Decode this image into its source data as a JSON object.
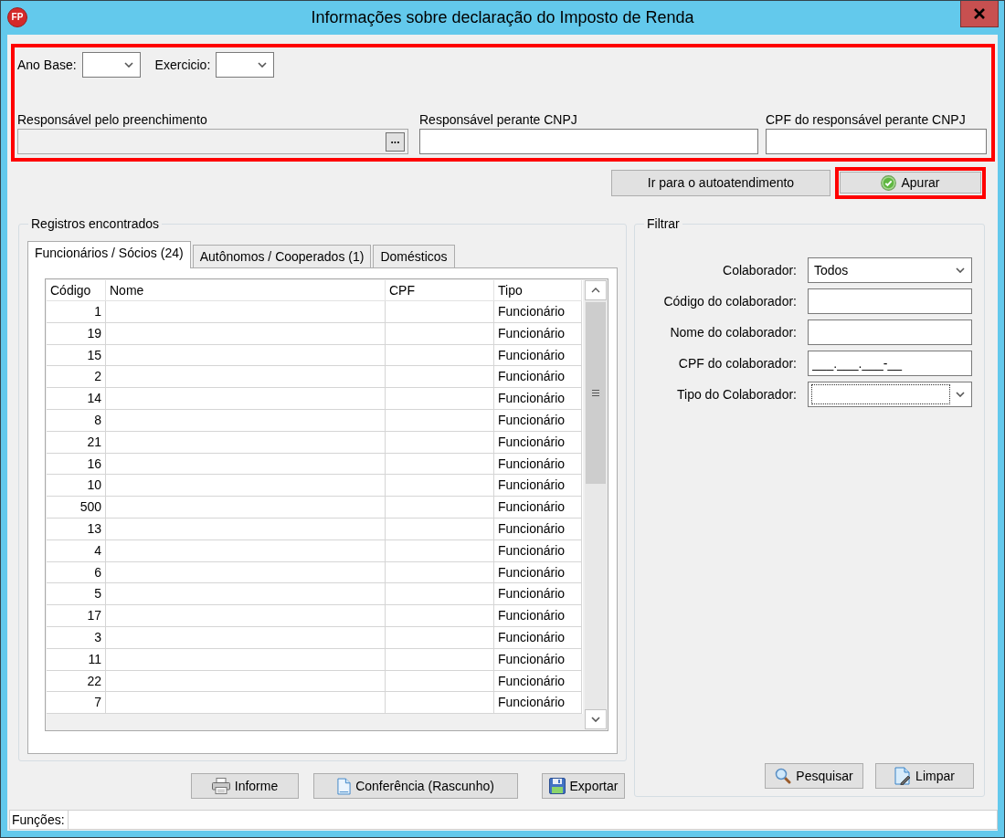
{
  "window": {
    "title": "Informações sobre declaração do Imposto de Renda",
    "logo_text": "FP"
  },
  "header_form": {
    "highlighted": true,
    "selects": [
      {
        "label": "Ano Base:"
      },
      {
        "label": "Exercicio:"
      }
    ],
    "fields": [
      {
        "label": "Responsável pelo preenchimento",
        "kind": "lookup",
        "disabled": true,
        "button": "..."
      },
      {
        "label": "Responsável perante CNPJ",
        "kind": "text",
        "disabled": false
      },
      {
        "label": "CPF do responsável perante CNPJ",
        "kind": "text",
        "disabled": false
      }
    ]
  },
  "actions": [
    {
      "label": "Ir para o autoatendimento",
      "highlighted": false
    },
    {
      "label": "Apurar",
      "highlighted": true
    }
  ],
  "records": {
    "legend": "Registros encontrados",
    "tabs": [
      {
        "label": "Funcionários / Sócios (24)",
        "selected": true
      },
      {
        "label": "Autônomos / Cooperados (1)",
        "selected": false
      },
      {
        "label": "Domésticos",
        "selected": false
      }
    ],
    "table": {
      "columns": [
        "Código",
        "Nome",
        "CPF",
        "Tipo"
      ],
      "rows": [
        {
          "codigo": "1",
          "tipo": "Funcionário"
        },
        {
          "codigo": "19",
          "tipo": "Funcionário"
        },
        {
          "codigo": "15",
          "tipo": "Funcionário"
        },
        {
          "codigo": "2",
          "tipo": "Funcionário"
        },
        {
          "codigo": "14",
          "tipo": "Funcionário"
        },
        {
          "codigo": "8",
          "tipo": "Funcionário"
        },
        {
          "codigo": "21",
          "tipo": "Funcionário"
        },
        {
          "codigo": "16",
          "tipo": "Funcionário"
        },
        {
          "codigo": "10",
          "tipo": "Funcionário"
        },
        {
          "codigo": "500",
          "tipo": "Funcionário"
        },
        {
          "codigo": "13",
          "tipo": "Funcionário"
        },
        {
          "codigo": "4",
          "tipo": "Funcionário"
        },
        {
          "codigo": "6",
          "tipo": "Funcionário"
        },
        {
          "codigo": "5",
          "tipo": "Funcionário"
        },
        {
          "codigo": "17",
          "tipo": "Funcionário"
        },
        {
          "codigo": "3",
          "tipo": "Funcionário"
        },
        {
          "codigo": "11",
          "tipo": "Funcionário"
        },
        {
          "codigo": "22",
          "tipo": "Funcionário"
        },
        {
          "codigo": "7",
          "tipo": "Funcionário"
        }
      ]
    }
  },
  "report_buttons": [
    {
      "label": "Informe"
    },
    {
      "label": "Conferência (Rascunho)"
    },
    {
      "label": "Exportar"
    }
  ],
  "filter": {
    "legend": "Filtrar",
    "fields": [
      {
        "kind": "select",
        "label": "Colaborador:",
        "value": "Todos",
        "focused": false
      },
      {
        "kind": "text",
        "label": "Código do colaborador:",
        "focused": false
      },
      {
        "kind": "text",
        "label": "Nome do colaborador:",
        "focused": false
      },
      {
        "kind": "text",
        "label": "CPF do colaborador:",
        "value": "___.___.___-__",
        "focused": false
      },
      {
        "kind": "select",
        "label": "Tipo do Colaborador:",
        "focused": true
      }
    ],
    "buttons": [
      {
        "label": "Pesquisar"
      },
      {
        "label": "Limpar"
      }
    ]
  },
  "status_bar": {
    "label": "Funções:"
  }
}
